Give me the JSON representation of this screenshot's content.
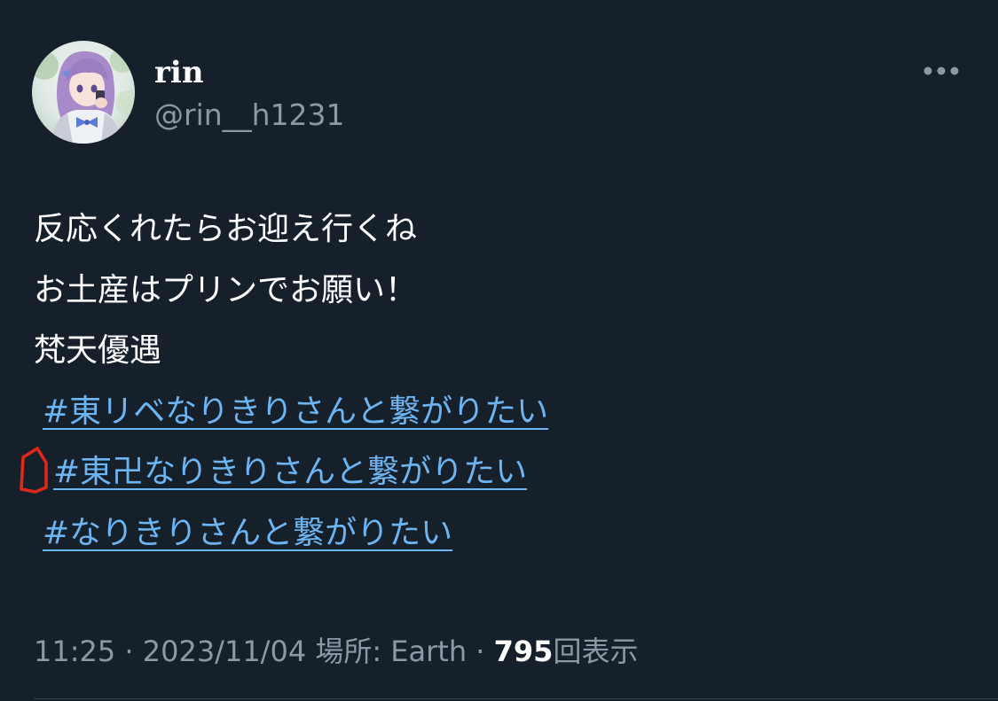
{
  "author": {
    "display_name": "rin",
    "handle": "@rin__h1231"
  },
  "tweet": {
    "lines": [
      "反応くれたらお迎え行くね",
      "お土産はプリンでお願い！",
      "梵天優遇"
    ],
    "hashtags": [
      "#東リベなりきりさんと繋がりたい",
      "#東卍なりきりさんと繋がりたい",
      "#なりきりさんと繋がりたい"
    ]
  },
  "meta": {
    "time": "11:25",
    "sep1": " · ",
    "date": "2023/11/04",
    "location_label": " 場所: Earth",
    "sep2": " · ",
    "views": "795",
    "views_label": "回表示"
  },
  "icons": {
    "more": "more-horizontal-icon"
  },
  "colors": {
    "background": "#15202b",
    "hashtag": "#6cb4f2",
    "secondary_text": "#8b98a5",
    "annotation": "#e0281a"
  }
}
